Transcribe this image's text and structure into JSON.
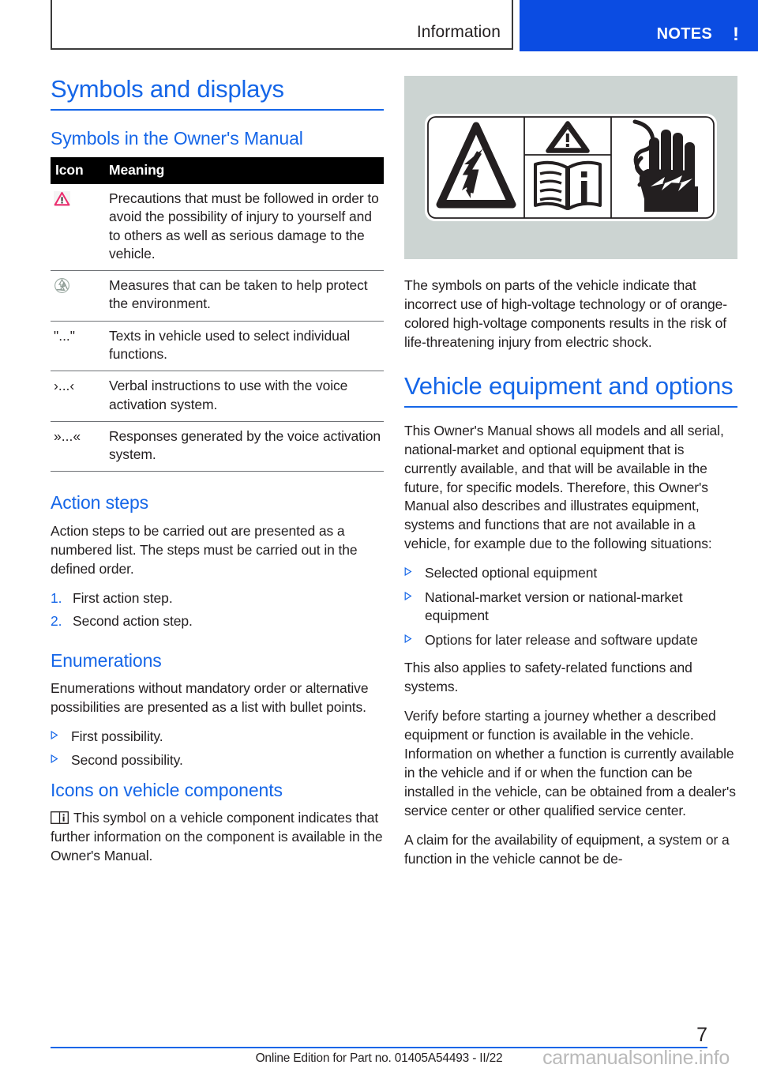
{
  "header": {
    "tab_information": "Information",
    "tab_notes": "NOTES",
    "tab_notes_mark": "!",
    "notes_color": "#0b4ce2"
  },
  "left_column": {
    "title": "Symbols and displays",
    "section_symbols_manual": "Symbols in the Owner's Manual",
    "table": {
      "headers": [
        "Icon",
        "Meaning"
      ],
      "rows": [
        {
          "icon": "warning-triangle-icon",
          "icon_text": "",
          "meaning": "Precautions that must be followed in order to avoid the possibility of injury to yourself and to others as well as serious damage to the vehicle."
        },
        {
          "icon": "recycle-icon",
          "icon_text": "",
          "meaning": "Measures that can be taken to help protect the environment."
        },
        {
          "icon": "text-quote",
          "icon_text": "\"...\"",
          "meaning": "Texts in vehicle used to select individual functions."
        },
        {
          "icon": "single-guillemet",
          "icon_text": "›...‹",
          "meaning": "Verbal instructions to use with the voice activation system."
        },
        {
          "icon": "double-guillemet",
          "icon_text": "»...«",
          "meaning": "Responses generated by the voice activation system."
        }
      ]
    },
    "section_action_steps": "Action steps",
    "action_steps_intro": "Action steps to be carried out are presented as a numbered list. The steps must be carried out in the defined order.",
    "action_steps": [
      {
        "num": "1.",
        "text": "First action step."
      },
      {
        "num": "2.",
        "text": "Second action step."
      }
    ],
    "section_enumerations": "Enumerations",
    "enumerations_intro": "Enumerations without mandatory order or alternative possibilities are presented as a list with bullet points.",
    "enumerations": [
      "First possibility.",
      "Second possibility."
    ],
    "section_icons_components": "Icons on vehicle components",
    "icons_components_text": "This symbol on a vehicle component indicates that further information on the component is available in the Owner's Manual."
  },
  "right_column": {
    "figure_name": "high-voltage-warning-label",
    "figure_caption": "The symbols on parts of the vehicle indicate that incorrect use of high-voltage technology or of orange-colored high-voltage components results in the risk of life-threatening injury from electric shock.",
    "title": "Vehicle equipment and options",
    "paragraph_1": "This Owner's Manual shows all models and all serial, national-market and optional equipment that is currently available, and that will be available in the future, for specific models. Therefore, this Owner's Manual also describes and illustrates equipment, systems and functions that are not available in a vehicle, for example due to the following situations:",
    "bullets": [
      "Selected optional equipment",
      "National-market version or national-market equipment",
      "Options for later release and software update"
    ],
    "paragraph_2": "This also applies to safety-related functions and systems.",
    "paragraph_3": "Verify before starting a journey whether a described equipment or function is available in the vehicle. Information on whether a function is currently available in the vehicle and if or when the function can be installed in the vehicle, can be obtained from a dealer's service center or other qualified service center.",
    "paragraph_4": "A claim for the availability of equipment, a system or a function in the vehicle cannot be de-"
  },
  "footer": {
    "note": "Online Edition for Part no. 01405A54493 - II/22",
    "page_number": "7",
    "watermark": "carmanualsonline.info"
  }
}
